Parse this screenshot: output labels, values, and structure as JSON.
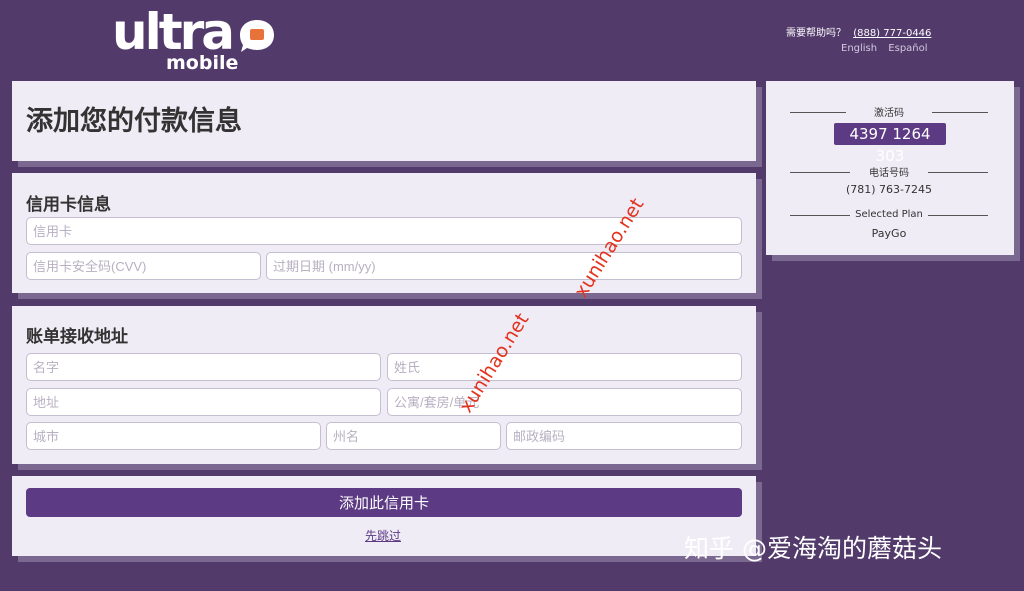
{
  "brand": {
    "logo_main": "ultra",
    "logo_sub": "mobile"
  },
  "header": {
    "help_text": "需要帮助吗？",
    "help_phone": "(888) 777-0446",
    "lang_english": "English",
    "lang_spanish": "Español"
  },
  "page_title": "添加您的付款信息",
  "credit_card": {
    "section_title": "信用卡信息",
    "card_placeholder": "信用卡",
    "cvv_placeholder": "信用卡安全码(CVV)",
    "expiry_placeholder": "过期日期 (mm/yy)"
  },
  "billing": {
    "section_title": "账单接收地址",
    "first_name_placeholder": "名字",
    "last_name_placeholder": "姓氏",
    "address_placeholder": "地址",
    "apt_placeholder": "公寓/套房/单元",
    "city_placeholder": "城市",
    "state_placeholder": "州名",
    "zip_placeholder": "邮政编码"
  },
  "actions": {
    "add_card_label": "添加此信用卡",
    "skip_label": "先跳过"
  },
  "sidebar": {
    "activation_label": "激活码",
    "activation_code": "4397 1264 303",
    "phone_label": "电话号码",
    "phone_value": "(781) 763-7245",
    "plan_label": "Selected Plan",
    "plan_value": "PayGo"
  },
  "watermarks": {
    "text1": "xunihao.net",
    "text2": "xunihao.net"
  },
  "credit": "知乎 @爱海淘的蘑菇头",
  "colors": {
    "background": "#523a6b",
    "accent": "#5c3a84",
    "card": "#f0ecf5",
    "logo_orange": "#e8733a"
  }
}
